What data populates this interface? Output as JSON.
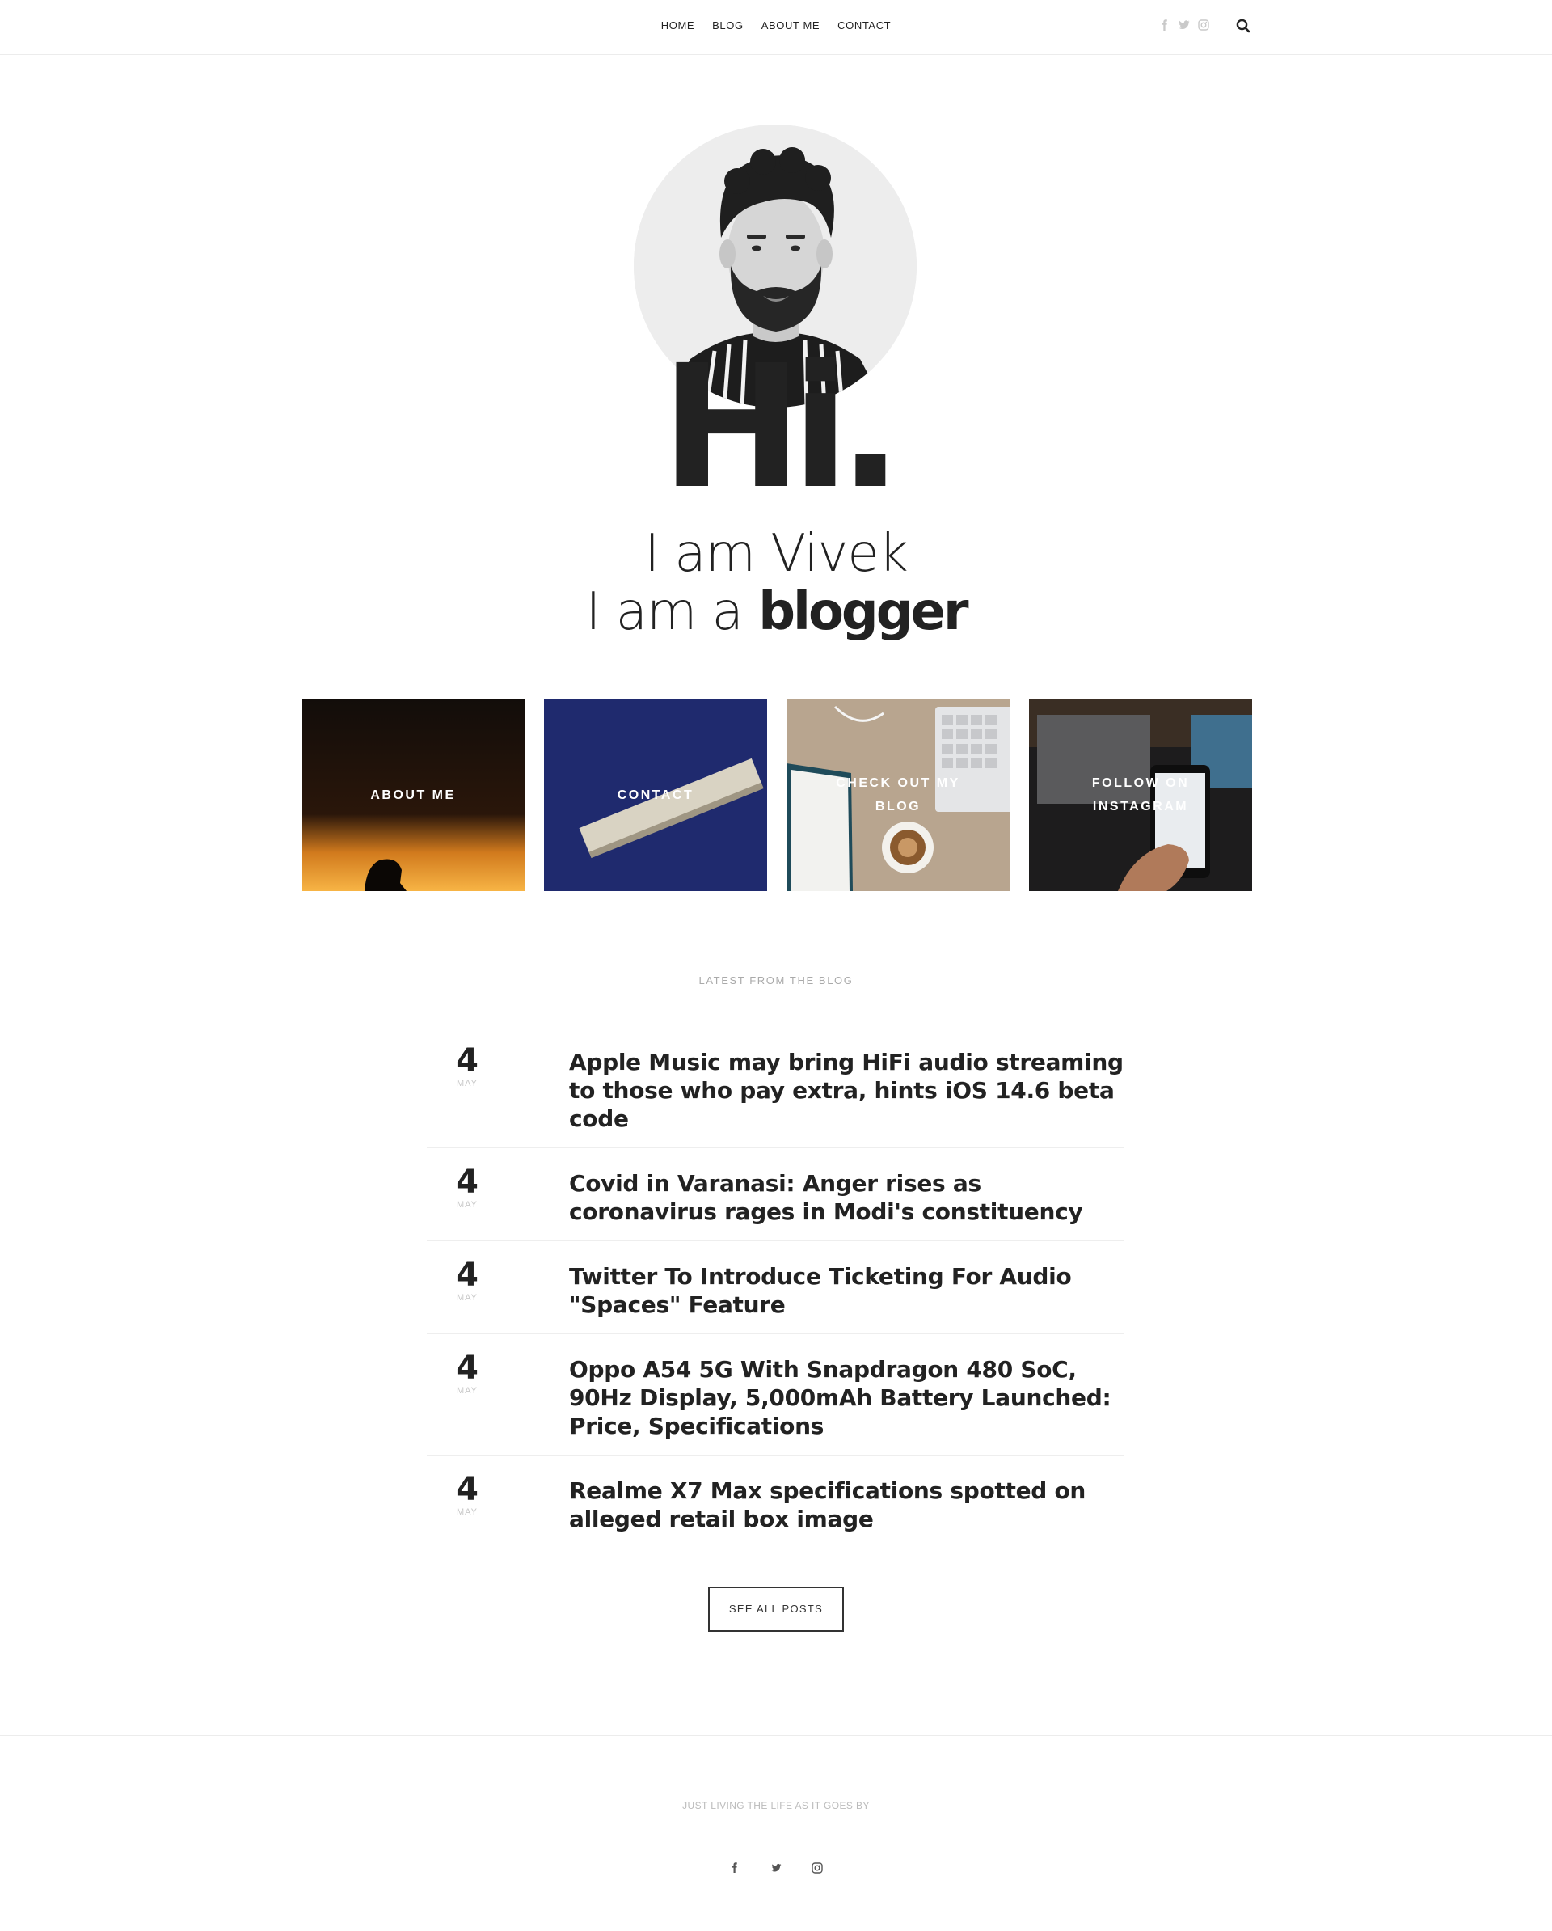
{
  "nav": {
    "items": [
      {
        "label": "HOME"
      },
      {
        "label": "BLOG"
      },
      {
        "label": "ABOUT ME"
      },
      {
        "label": "CONTACT"
      }
    ],
    "social_icons": [
      "facebook-icon",
      "twitter-icon",
      "instagram-icon"
    ],
    "search_icon": "search-icon"
  },
  "hero": {
    "greeting": "Hi.",
    "line1": "I am Vivek",
    "line2_prefix": "I am a ",
    "line2_bold": "blogger"
  },
  "tiles": [
    {
      "label": "ABOUT ME"
    },
    {
      "label": "CONTACT"
    },
    {
      "label": "CHECK OUT MY BLOG"
    },
    {
      "label": "FOLLOW ON INSTAGRAM"
    }
  ],
  "latest": {
    "heading": "LATEST FROM THE BLOG",
    "posts": [
      {
        "day": "4",
        "month": "MAY",
        "title": "Apple Music may bring HiFi audio streaming to those who pay extra, hints iOS 14.6 beta code"
      },
      {
        "day": "4",
        "month": "MAY",
        "title": "Covid in Varanasi: Anger rises as coronavirus rages in Modi's constituency"
      },
      {
        "day": "4",
        "month": "MAY",
        "title": "Twitter To Introduce Ticketing For Audio \"Spaces\" Feature"
      },
      {
        "day": "4",
        "month": "MAY",
        "title": "Oppo A54 5G With Snapdragon 480 SoC, 90Hz Display, 5,000mAh Battery Launched: Price, Specifications"
      },
      {
        "day": "4",
        "month": "MAY",
        "title": "Realme X7 Max specifications spotted on alleged retail box image"
      }
    ],
    "see_all": "SEE ALL POSTS"
  },
  "footer": {
    "tagline": "JUST LIVING THE LIFE AS IT GOES BY",
    "social_icons": [
      "facebook-icon",
      "twitter-icon",
      "instagram-icon"
    ]
  },
  "colors": {
    "text": "#222222",
    "muted": "#aaaaaa",
    "contact_tile": "#1f2a6e"
  }
}
